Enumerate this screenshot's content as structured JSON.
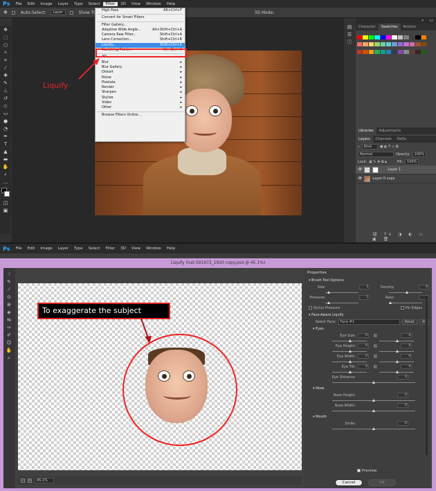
{
  "top": {
    "app_logo": "Ps",
    "menu": [
      "File",
      "Edit",
      "Image",
      "Layer",
      "Type",
      "Select",
      "Filter",
      "3D",
      "View",
      "Window",
      "Help"
    ],
    "active_menu": "Filter",
    "options": {
      "auto_select": "Auto-Select:",
      "layer": "Layer",
      "show_transform": "Show Transform",
      "mode_3d": "3D Mode:"
    },
    "filter_menu": [
      {
        "label": "High Pass",
        "shortcut": "Alt+Ctrl+F"
      },
      {
        "sep": true
      },
      {
        "label": "Convert for Smart Filters",
        "shortcut": ""
      },
      {
        "sep": true
      },
      {
        "label": "Filter Gallery...",
        "shortcut": ""
      },
      {
        "label": "Adaptive Wide Angle...",
        "shortcut": "Alt+Shift+Ctrl+A"
      },
      {
        "label": "Camera Raw Filter...",
        "shortcut": "Shift+Ctrl+A"
      },
      {
        "label": "Lens Correction...",
        "shortcut": "Shift+Ctrl+R"
      },
      {
        "label": "Liquify...",
        "shortcut": "Shift+Ctrl+X",
        "highlight": true
      },
      {
        "label": "Vanishing Point...",
        "shortcut": "Alt+Ctrl+V"
      },
      {
        "sep": true
      },
      {
        "label": "3D",
        "shortcut": "▸"
      },
      {
        "label": "Blur",
        "shortcut": "▸"
      },
      {
        "label": "Blur Gallery",
        "shortcut": "▸"
      },
      {
        "label": "Distort",
        "shortcut": "▸"
      },
      {
        "label": "Noise",
        "shortcut": "▸"
      },
      {
        "label": "Pixelate",
        "shortcut": "▸"
      },
      {
        "label": "Render",
        "shortcut": "▸"
      },
      {
        "label": "Sharpen",
        "shortcut": "▸"
      },
      {
        "label": "Stylize",
        "shortcut": "▸"
      },
      {
        "label": "Video",
        "shortcut": "▸"
      },
      {
        "label": "Other",
        "shortcut": "▸"
      },
      {
        "sep": true
      },
      {
        "label": "Browse Filters Online...",
        "shortcut": ""
      }
    ],
    "annotation_liquify": "Liquify",
    "panel_tabs_top": [
      "Character",
      "Swatches",
      "Actions"
    ],
    "panel_tabs_mid": [
      "Libraries",
      "Adjustments"
    ],
    "layers_tabs": [
      "Layers",
      "Channels",
      "Paths"
    ],
    "kind": "Kind",
    "blend_mode": "Normal",
    "opacity": {
      "label": "Opacity:",
      "value": "100%"
    },
    "fill": {
      "label": "Fill:",
      "value": "100%"
    },
    "lock_label": "Lock:",
    "layers": [
      "Layer 1",
      "Layer 0 copy"
    ],
    "swatch_colors": [
      "#ff0000",
      "#ffff00",
      "#00ff00",
      "#00ffff",
      "#0000ff",
      "#ff00ff",
      "#ffffff",
      "#c0c0c0",
      "#808080",
      "#404040",
      "#000000",
      "#ff8000",
      "#f26d6d",
      "#f7a56a",
      "#fbd46c",
      "#9ed46c",
      "#6cd49e",
      "#6cc9d4",
      "#6c9ed4",
      "#8a6cd4",
      "#c26cd4",
      "#d46ca6",
      "#a0522d",
      "#8b4513",
      "#c0392b",
      "#d35400",
      "#f39c12",
      "#27ae60",
      "#16a085",
      "#2980b9",
      "#2c3e50",
      "#8e44ad",
      "#7f8c8d",
      "#5d4037",
      "#3e2723",
      "#1b5e20"
    ]
  },
  "bottom": {
    "app_logo": "Ps",
    "menu": [
      "File",
      "Edit",
      "Image",
      "Layer",
      "Type",
      "Select",
      "Filter",
      "3D",
      "View",
      "Window",
      "Help"
    ],
    "title": "Liquify (hat-591973_1920 copy.psd @ 45.1%)",
    "zoom": "45.1%",
    "callout": "To exaggerate the subject",
    "properties": {
      "title": "Properties",
      "brush_section": "Brush Tool Options",
      "size": "Size:",
      "size_val": "1",
      "density": "Density:",
      "density_val": "0",
      "pressure": "Pressure:",
      "pressure_val": "1",
      "rate": "Rate:",
      "rate_val": "0",
      "stylus_pressure": "Stylus Pressure",
      "pin_edges": "Pin Edges",
      "face_section": "Face-Aware Liquify",
      "select_face": "Select Face:",
      "face_value": "Face #1",
      "reset": "Reset",
      "all": "All",
      "eyes_section": "Eyes",
      "eye_size": "Eye Size:",
      "eye_height": "Eye Height:",
      "eye_width": "Eye Width:",
      "eye_tilt": "Eye Tilt:",
      "eye_distance": "Eye Distance:",
      "nose_section": "Nose",
      "nose_height": "Nose Height:",
      "nose_width": "Nose Width:",
      "mouth_section": "Mouth",
      "smile": "Smile:",
      "zero": "0",
      "preview": "Preview",
      "cancel": "Cancel",
      "ok": "OK"
    }
  }
}
